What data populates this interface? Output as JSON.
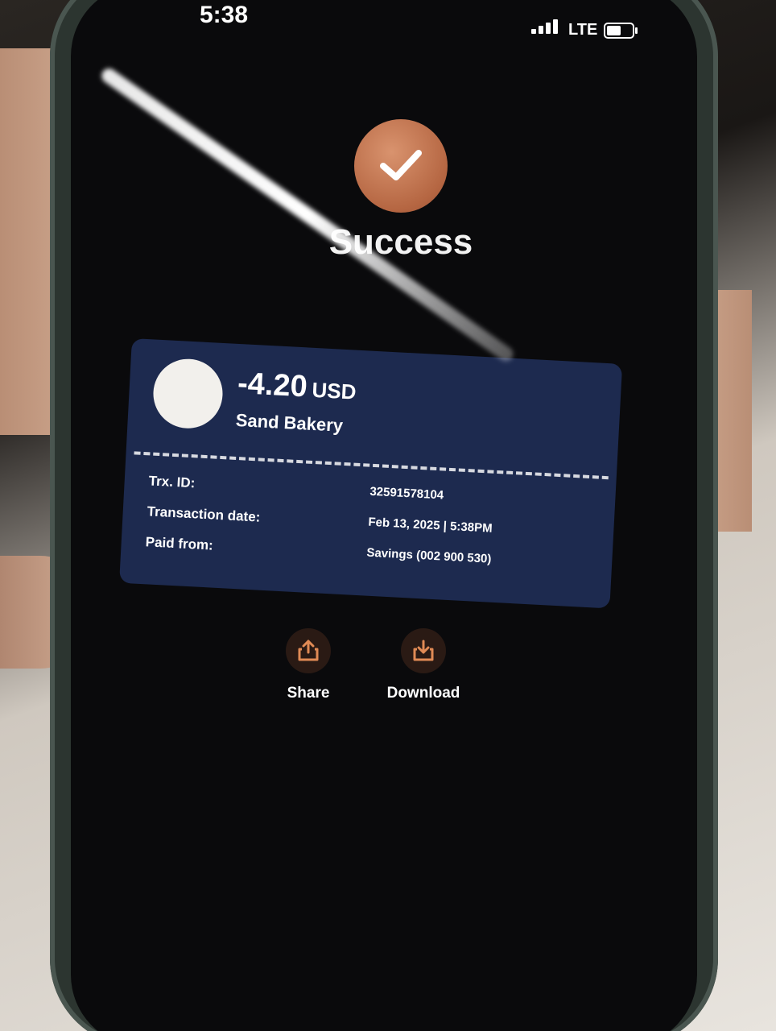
{
  "statusbar": {
    "time": "5:38",
    "network": "LTE",
    "battery_level": 0.55
  },
  "success": {
    "title": "Success",
    "icon": "checkmark-icon",
    "color": "#c17450"
  },
  "receipt": {
    "amount": "-4.20",
    "currency": "USD",
    "merchant": "Sand Bakery",
    "background_color": "#1d2a4f",
    "details": [
      {
        "label": "Trx. ID:",
        "value": "32591578104"
      },
      {
        "label": "Transaction date:",
        "value": "Feb 13, 2025 | 5:38PM"
      },
      {
        "label": "Paid from:",
        "value": "Savings (002 900 530)"
      }
    ]
  },
  "actions": {
    "share": {
      "label": "Share",
      "icon": "share-icon"
    },
    "download": {
      "label": "Download",
      "icon": "download-icon"
    },
    "accent_color": "#e08a55"
  }
}
